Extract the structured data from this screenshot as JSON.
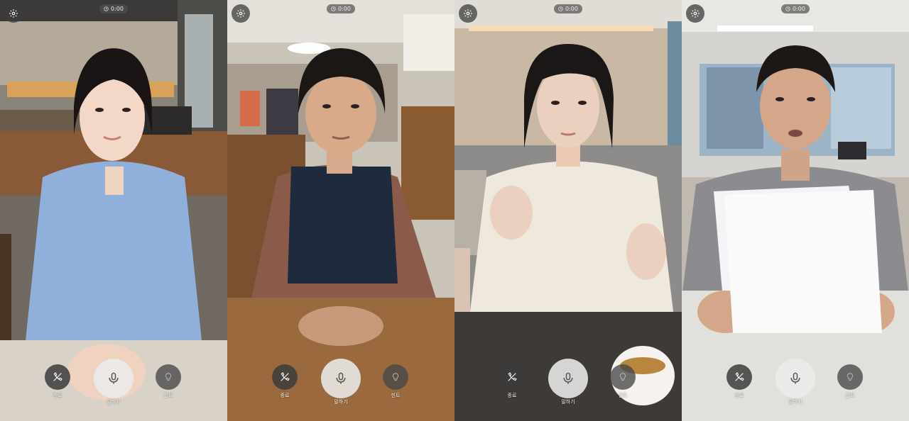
{
  "panels": [
    {
      "id": "cafe-young-woman",
      "timer": "0:00",
      "buttons": {
        "end": "종료",
        "talk": "말하기",
        "hint": "힌트"
      }
    },
    {
      "id": "restaurant-older-woman",
      "timer": "0:00",
      "buttons": {
        "end": "종료",
        "talk": "말하기",
        "hint": "힌트"
      }
    },
    {
      "id": "cafe-woman-sweater",
      "timer": "0:00",
      "buttons": {
        "end": "종료",
        "talk": "말하기",
        "hint": "힌트"
      }
    },
    {
      "id": "office-man-papers",
      "timer": "0:00",
      "buttons": {
        "end": "종료",
        "talk": "말하기",
        "hint": "힌트"
      }
    }
  ],
  "icons": {
    "settings": "gear-icon",
    "timer": "clock-icon",
    "end": "phone-hangup-icon",
    "talk": "microphone-icon",
    "hint": "lightbulb-icon"
  },
  "colors": {
    "control_dark": "#3c3c3c",
    "talk_button": "#ebebeb",
    "label_text": "#f0f0f0"
  }
}
